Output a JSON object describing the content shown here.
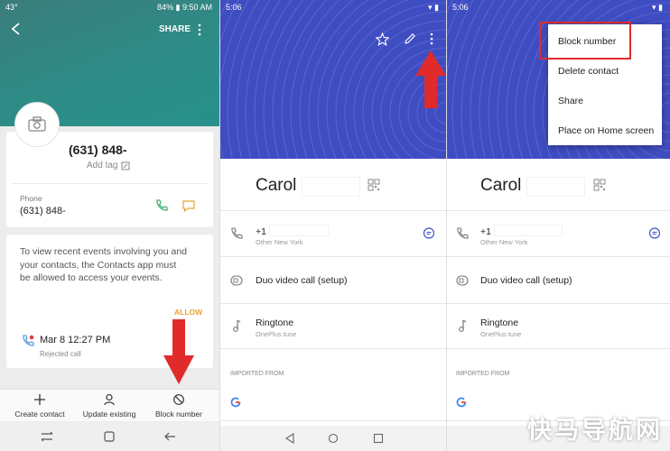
{
  "panel1": {
    "status_left": "43°",
    "status_right": "84% ▮ 9:50 AM",
    "share_label": "SHARE",
    "phone_number_title": "(631) 848-",
    "add_tag_label": "Add tag",
    "phone_field_label": "Phone",
    "phone_field_value": "(631) 848-",
    "recent_events_text": "To view recent events involving you and your contacts, the Contacts app must be allowed to access your events.",
    "allow_label": "ALLOW",
    "call_datetime": "Mar 8 12:27 PM",
    "call_status": "Rejected call",
    "bottom_actions": [
      {
        "label": "Create contact",
        "icon": "plus-icon"
      },
      {
        "label": "Update existing",
        "icon": "person-icon"
      },
      {
        "label": "Block number",
        "icon": "block-icon"
      }
    ],
    "colors": {
      "header": "#2e8c87",
      "allow": "#e8a33a",
      "arrow": "#e12a2a"
    }
  },
  "panel2": {
    "status_time": "5:06",
    "contact_name": "Carol",
    "phone_prefix": "+1",
    "phone_location": "Other New York",
    "duo_label": "Duo video call (setup)",
    "ringtone_label": "Ringtone",
    "ringtone_value": "OnePlus tune",
    "imported_from_label": "IMPORTED FROM",
    "colors": {
      "banner": "#3f4dc2",
      "message_icon": "#3c54c8"
    }
  },
  "panel3": {
    "status_time": "5:06",
    "contact_name": "Carol",
    "phone_prefix": "+1",
    "phone_location": "Other New York",
    "duo_label": "Duo video call (setup)",
    "ringtone_label": "Ringtone",
    "ringtone_value": "OnePlus tune",
    "imported_from_label": "IMPORTED FROM",
    "menu_items": [
      "Block number",
      "Delete contact",
      "Share",
      "Place on Home screen"
    ]
  },
  "watermark_text": "快马导航网"
}
